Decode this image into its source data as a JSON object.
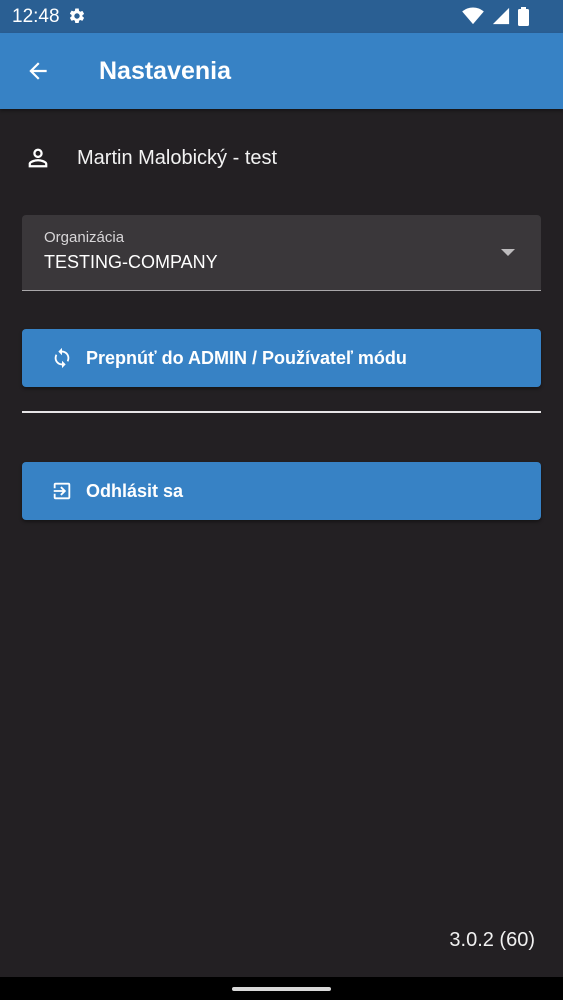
{
  "status_bar": {
    "time": "12:48",
    "icons": [
      "gear-icon",
      "wifi-icon",
      "signal-icon",
      "battery-icon"
    ]
  },
  "app_bar": {
    "title": "Nastavenia",
    "back_icon": "arrow-left-icon"
  },
  "user": {
    "icon": "person-icon",
    "name": "Martin Malobický - test"
  },
  "organization": {
    "label": "Organizácia",
    "value": "TESTING-COMPANY",
    "caret_icon": "caret-down-icon"
  },
  "buttons": {
    "switch_mode": {
      "label": "Prepnúť do ADMIN / Používateľ módu",
      "icon": "sync-icon"
    },
    "logout": {
      "label": "Odhlásit sa",
      "icon": "logout-icon"
    }
  },
  "version": "3.0.2 (60)",
  "colors": {
    "background": "#232023",
    "status_bar": "#2a5f93",
    "primary": "#3782c5",
    "field": "#3a373a"
  }
}
